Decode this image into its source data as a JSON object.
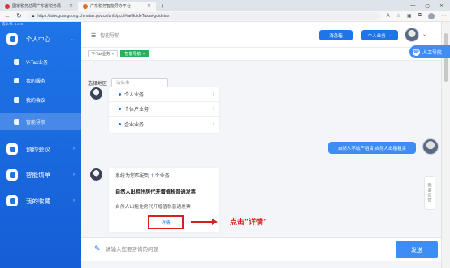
{
  "browser": {
    "tabs": [
      {
        "title": "国家税务总局广东省税务局",
        "active": false,
        "icon_color": "#d33"
      },
      {
        "title": "广东税务智能导办平台",
        "active": true,
        "icon_color": "#e86a1a"
      }
    ],
    "new_tab": "+",
    "url": "https://tsfw.guangdong.chinatax.gov.cn/znfs/pcc/#/aiGuideTax/ai-guidetax"
  },
  "sidebar": {
    "version": "版本号: 1.0.8",
    "items": [
      {
        "label": "个人中心",
        "type": "main",
        "arrow": "⌄"
      },
      {
        "label": "V-Tax业务",
        "type": "sub"
      },
      {
        "label": "我的服务",
        "type": "sub"
      },
      {
        "label": "我的会议",
        "type": "sub"
      },
      {
        "label": "智能导航",
        "type": "sub",
        "active": true
      },
      {
        "label": "预约会议",
        "type": "main",
        "arrow": "›"
      },
      {
        "label": "智能填单",
        "type": "main",
        "arrow": "›"
      },
      {
        "label": "我的收藏",
        "type": "main",
        "arrow": "›"
      }
    ]
  },
  "topbar": {
    "breadcrumb": "智能导航",
    "message_button": "消息箱",
    "business_button": "个人业务",
    "kefu_button": "人工导航"
  },
  "chips": [
    {
      "label": "V-Tax业务",
      "active": false
    },
    {
      "label": "智能导航",
      "active": true
    }
  ],
  "region": {
    "label": "选择地区",
    "value": "汕头市"
  },
  "options": [
    "个人业务",
    "个体户业务",
    "企业业务"
  ],
  "user_message": "自然人不动产租赁-自然人出租租赁",
  "feedback_tab": "我要反馈",
  "answer": {
    "head_prefix": "系统为您匹配到",
    "head_count": "1",
    "head_suffix": "个业务",
    "title": "自然人出租住房代开增值税普通发票",
    "subtitle": "自然人出租住房代开增值税普通发票",
    "detail_button": "详情"
  },
  "annotation": {
    "callout": "点击“详情”",
    "color": "#d82020"
  },
  "input": {
    "placeholder": "请输入您要咨询的问题",
    "send_button": "发送"
  },
  "colors": {
    "brand": "#1f74e8",
    "accent": "#3e8df5",
    "chip_active": "#27b15a"
  }
}
